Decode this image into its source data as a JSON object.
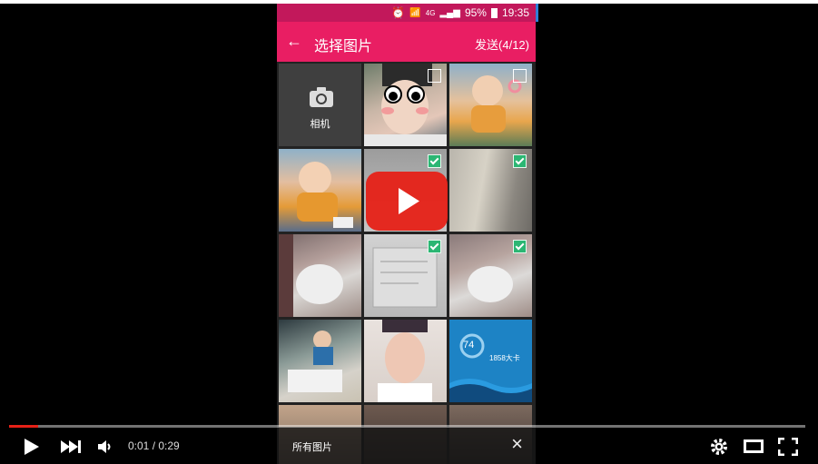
{
  "status_bar": {
    "signal_label": "4G",
    "battery": "95%",
    "time": "19:35"
  },
  "app_bar": {
    "title": "选择图片",
    "send": "发送(4/12)"
  },
  "camera": {
    "label": "相机"
  },
  "health_card": {
    "score": "74",
    "calories": "1858大卡"
  },
  "bottom_bar": {
    "album": "所有图片"
  },
  "player": {
    "time": "0:01 / 0:29",
    "progress": 0.036
  },
  "colors": {
    "accent": "#e91e63",
    "status": "#c2185b",
    "check": "#2bb673",
    "youtube_red": "#e62117"
  }
}
